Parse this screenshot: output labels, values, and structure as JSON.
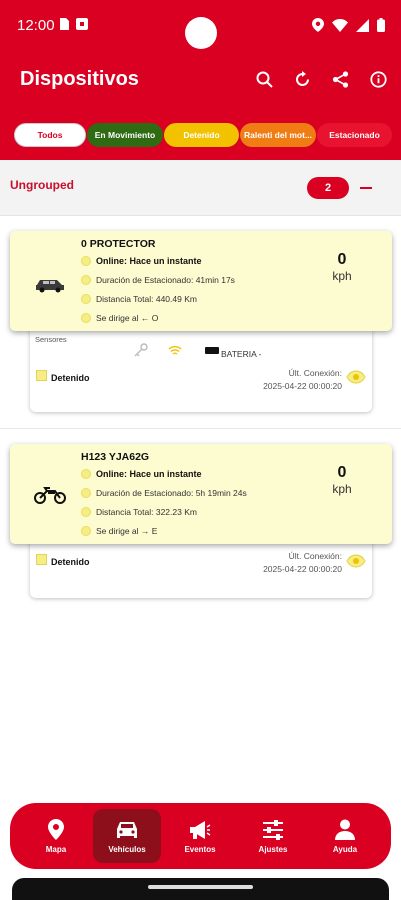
{
  "status_bar": {
    "time": "12:00"
  },
  "header": {
    "title": "Dispositivos",
    "actions": [
      "search-icon",
      "refresh-icon",
      "share-icon",
      "info-icon"
    ]
  },
  "filters": [
    {
      "label": "Todos",
      "bg": "#ffffff",
      "fg": "#d90022"
    },
    {
      "label": "En Movimiento",
      "bg": "#2e6b12",
      "fg": "#ffffff"
    },
    {
      "label": "Detenido",
      "bg": "#f2c200",
      "fg": "#ffffff"
    },
    {
      "label": "Ralenti del mot...",
      "bg": "#f07c14",
      "fg": "#ffffff"
    },
    {
      "label": "Estacionado",
      "bg": "#e8132e",
      "fg": "#ffffff"
    }
  ],
  "group": {
    "name": "Ungrouped",
    "count": "2",
    "collapse_symbol": "—"
  },
  "vehicles": [
    {
      "name": "0 PROTECTOR",
      "icon": "car-icon",
      "online": "Online: Hace un instante",
      "parked": "Duración de Estacionado: 41min 17s",
      "distance": "Distancia Total: 440.49 Km",
      "heading": "Se dirige al ← O",
      "speed": "0",
      "speed_unit": "kph",
      "sensors_label": "Sensores",
      "battery_label": "BATERIA -",
      "state": "Detenido",
      "conn_label": "Últ. Conexión:",
      "conn_time": "2025-04-22 00:00:20"
    },
    {
      "name": "H123 YJA62G",
      "icon": "motorcycle-icon",
      "online": "Online: Hace un instante",
      "parked": "Duración de Estacionado: 5h 19min 24s",
      "distance": "Distancia Total: 322.23 Km",
      "heading": "Se dirige al → E",
      "speed": "0",
      "speed_unit": "kph",
      "state": "Detenido",
      "conn_label": "Últ. Conexión:",
      "conn_time": "2025-04-22 00:00:20"
    }
  ],
  "bottom_nav": [
    {
      "label": "Mapa",
      "icon": "map-pin-icon",
      "active": false
    },
    {
      "label": "Vehículos",
      "icon": "car-icon",
      "active": true
    },
    {
      "label": "Eventos",
      "icon": "megaphone-icon",
      "active": false
    },
    {
      "label": "Ajustes",
      "icon": "sliders-icon",
      "active": false
    },
    {
      "label": "Ayuda",
      "icon": "person-icon",
      "active": false
    }
  ]
}
